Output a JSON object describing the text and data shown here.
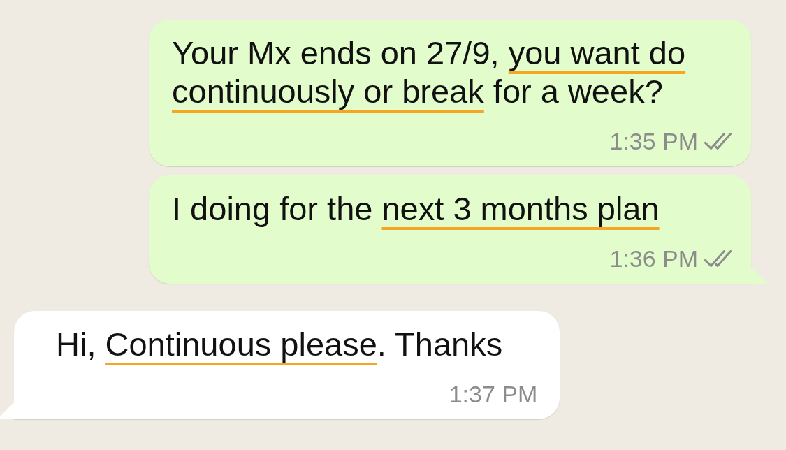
{
  "messages": [
    {
      "kind": "sent",
      "segments": [
        {
          "text": "Your Mx ends on 27/9, ",
          "underlined": false
        },
        {
          "text": "you want do continuously or break",
          "underlined": true
        },
        {
          "text": " for a week?",
          "underlined": false
        }
      ],
      "time": "1:35 PM",
      "read": false,
      "tail": false
    },
    {
      "kind": "sent",
      "segments": [
        {
          "text": "I doing for the ",
          "underlined": false
        },
        {
          "text": "next 3 months plan",
          "underlined": true
        }
      ],
      "time": "1:36 PM",
      "read": false,
      "tail": true
    },
    {
      "kind": "received",
      "segments": [
        {
          "text": "Hi, ",
          "underlined": false
        },
        {
          "text": "Continuous please",
          "underlined": true
        },
        {
          "text": ". Thanks",
          "underlined": false
        }
      ],
      "time": "1:37 PM",
      "tail": true
    }
  ]
}
